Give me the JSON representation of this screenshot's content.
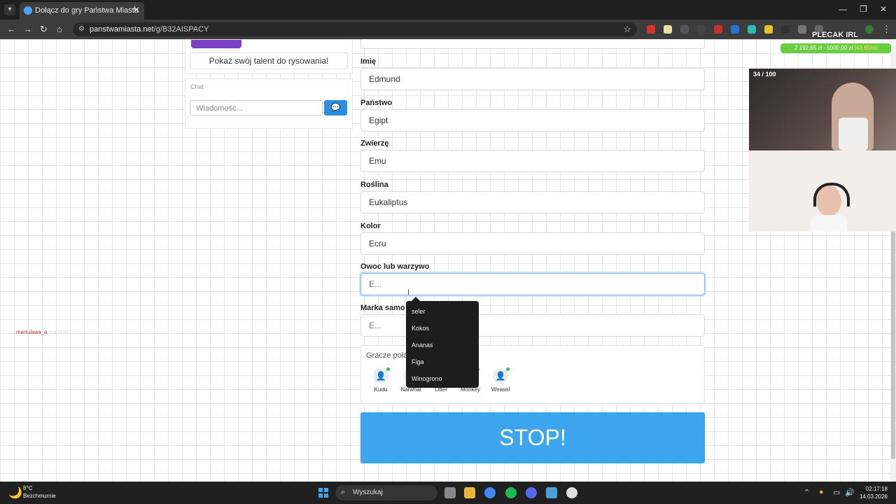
{
  "browser": {
    "tab_title": "Dołącz do gry Państwa Miasta",
    "url_host": "panstwamiasta.net",
    "url_path": "/g/B32AISPACY"
  },
  "left": {
    "talent_button": "Pokaż swój talent do rysowania!",
    "chat_label": "Chat",
    "chat_placeholder": "Wiadomość...",
    "user_name": "martulaaa_a",
    "user_suffix": "ma bota"
  },
  "form": {
    "fields": [
      {
        "label": "Imię",
        "value": "Edmund"
      },
      {
        "label": "Państwo",
        "value": "Egipt"
      },
      {
        "label": "Zwierzę",
        "value": "Emu"
      },
      {
        "label": "Roślina",
        "value": "Eukaliptus"
      },
      {
        "label": "Kolor",
        "value": "Ecru"
      },
      {
        "label": "Owoc lub warzywo",
        "value": "E..."
      },
      {
        "label": "Marka samo",
        "value": "E..."
      }
    ],
    "suggestions": [
      "seler",
      "Kokos",
      "Ananas",
      "Figa",
      "Winogrono"
    ],
    "players_title": "Gracze połą",
    "players": [
      "Kudu",
      "Narwhal",
      "Otter",
      "Monkey",
      "Weasel"
    ],
    "stop_label": "STOP!"
  },
  "overlay": {
    "title": "PLECAK IRL",
    "progress_text": "2 192,65 zł - 5000,00 zł",
    "progress_pct": "(43.85%)",
    "progress_fraction": 0.4385,
    "cam_count": "34 / 100"
  },
  "taskbar": {
    "temp": "8°C",
    "weather": "Bezchmurnie",
    "search": "Wyszukaj",
    "time": "02:17:18",
    "date": "14.03.2026"
  },
  "colors": {
    "stop": "#3da5ee",
    "accent": "#2a8fdf",
    "progress": "#6acc3f"
  }
}
